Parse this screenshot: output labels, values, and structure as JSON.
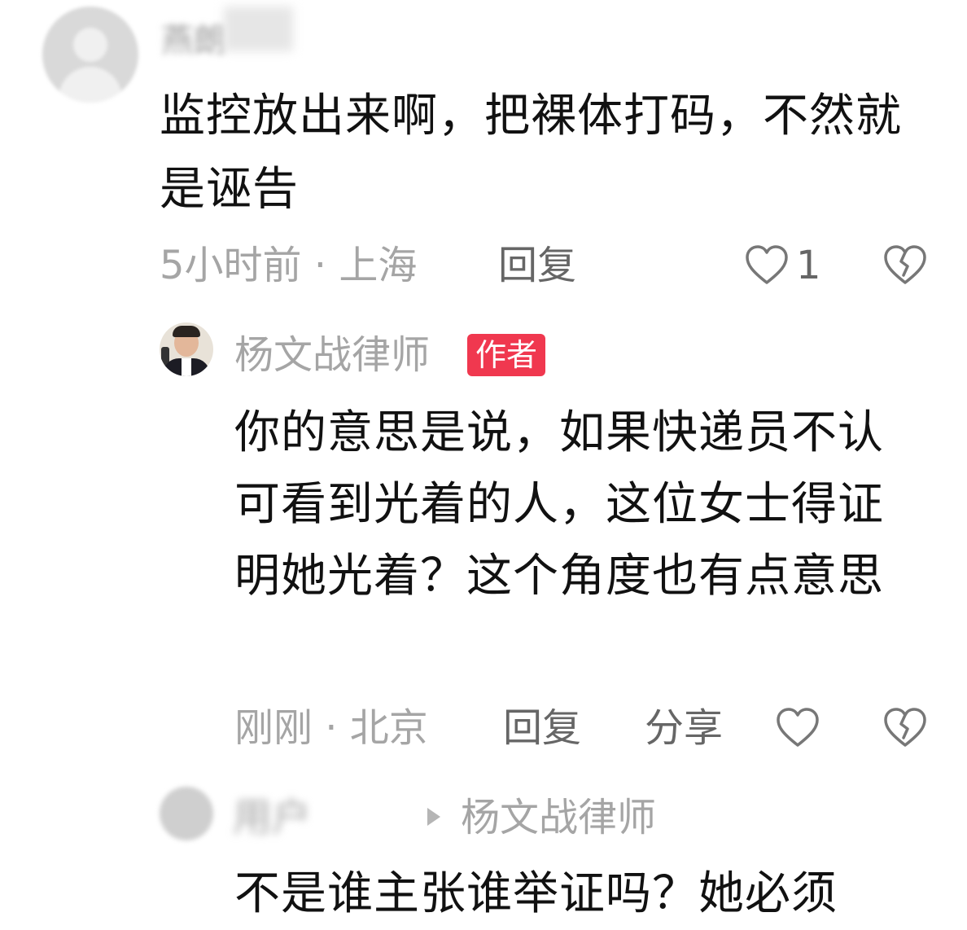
{
  "comments": [
    {
      "author": "燕朗",
      "text": "监控放出来啊，把裸体打码，不然就是诬告",
      "meta": "5小时前 · 上海",
      "reply_label": "回复",
      "like_count": "1"
    },
    {
      "author": "杨文战律师",
      "badge": "作者",
      "text": "你的意思是说，如果快递员不认可看到光着的人，这位女士得证明她光着？这个角度也有点意思",
      "meta": "刚刚 · 北京",
      "reply_label": "回复",
      "share_label": "分享"
    },
    {
      "author": "用户",
      "reply_to": "杨文战律师",
      "text": "不是谁主张谁举证吗？她必须"
    }
  ],
  "icons": {
    "like": "heart-outline-icon",
    "dislike": "broken-heart-icon",
    "reply_arrow": "triangle-right-icon"
  },
  "colors": {
    "text_primary": "#111111",
    "text_secondary": "#a5a5a5",
    "action_text": "#666666",
    "badge_bg": "#f0384f",
    "badge_text": "#ffffff"
  }
}
